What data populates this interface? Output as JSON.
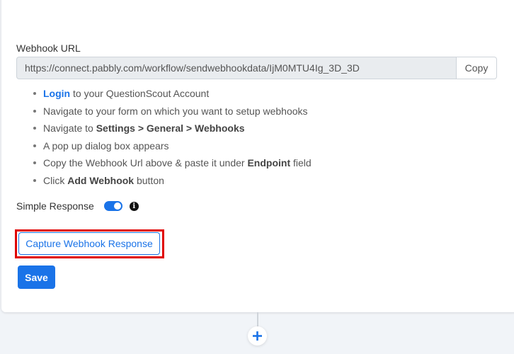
{
  "webhook": {
    "label": "Webhook URL",
    "url": "https://connect.pabbly.com/workflow/sendwebhookdata/IjM0MTU4Ig_3D_3D",
    "copy_label": "Copy"
  },
  "steps": [
    {
      "link": "Login",
      "text": " to your QuestionScout Account"
    },
    {
      "text": "Navigate to your form on which you want to setup webhooks"
    },
    {
      "pre": "Navigate to ",
      "bold": "Settings > General > Webhooks",
      "post": ""
    },
    {
      "text": "A pop up dialog box appears"
    },
    {
      "pre": "Copy the Webhook Url above & paste it under ",
      "bold": "Endpoint",
      "post": " field"
    },
    {
      "pre": "Click ",
      "bold": "Add Webhook",
      "post": " button"
    }
  ],
  "simple_response": {
    "label": "Simple Response",
    "enabled": true,
    "info_icon": "info-circle-icon"
  },
  "buttons": {
    "capture": "Capture Webhook Response",
    "save": "Save",
    "add": "+"
  },
  "colors": {
    "accent": "#1a73e8",
    "highlight": "#e00000"
  }
}
